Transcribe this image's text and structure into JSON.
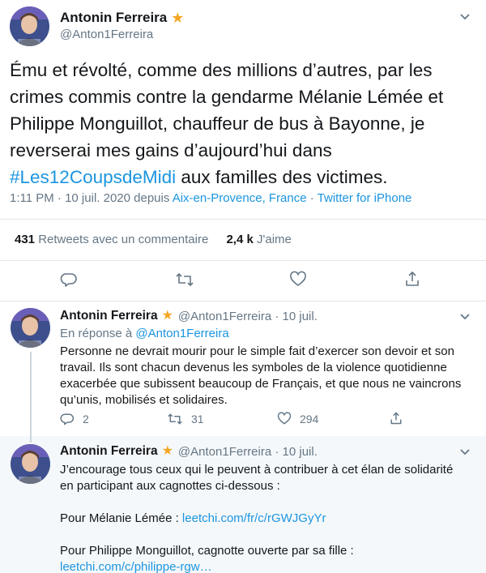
{
  "main_tweet": {
    "author_name": "Antonin Ferreira",
    "verified_star": "★",
    "handle": "@Anton1Ferreira",
    "text_line1": "Ému et révolté, comme des millions d’autres, par les",
    "text_line2": "crimes commis contre la gendarme Mélanie Lémée et",
    "text_line3": "Philippe Monguillot, chauffeur de bus à Bayonne, je",
    "text_line4": "reverserai mes gains d’aujourd’hui dans",
    "hashtag": "#Les12CoupsdeMidi",
    "text_line5_rest": " aux familles des victimes.",
    "time": "1:11 PM · 10 juil. 2020 depuis ",
    "location": "Aix-en-Provence, France",
    "separator": " · ",
    "source": "Twitter for iPhone",
    "retweets_count": "431",
    "retweets_label": " Retweets avec un commentaire",
    "likes_count": "2,4 k",
    "likes_label": " J'aime"
  },
  "reply_1": {
    "author_name": "Antonin Ferreira",
    "verified_star": "★",
    "handle_date": "@Anton1Ferreira · 10 juil.",
    "reply_prefix": "En réponse à ",
    "reply_handle": "@Anton1Ferreira",
    "line1": "Personne ne devrait mourir pour le simple fait d’exercer son devoir et son",
    "line2": "travail. Ils sont chacun devenus les symboles de la violence quotidienne",
    "line3": "exacerbée que subissent beaucoup de Français, et que nous ne vaincrons",
    "line4": "qu’unis, mobilisés et solidaires.",
    "reply_count": "2",
    "retweet_count": "31",
    "like_count": "294"
  },
  "reply_2": {
    "author_name": "Antonin Ferreira",
    "verified_star": "★",
    "handle_date": "@Anton1Ferreira · 10 juil.",
    "line1": "J’encourage tous ceux qui le peuvent à contribuer à cet élan de solidarité",
    "line2": "en participant aux cagnottes ci-dessous :",
    "line3_prefix": "Pour Mélanie Lémée : ",
    "line3_link": "leetchi.com/fr/c/rGWJGyYr",
    "line4": "Pour Philippe Monguillot, cagnotte ouverte par sa fille :",
    "line5_link": "leetchi.com/c/philippe-rgw…"
  },
  "icons": {
    "reply": "reply-icon",
    "retweet": "retweet-icon",
    "like": "heart-icon",
    "share": "share-icon",
    "more": "chevron-down-icon",
    "verified": "star-icon"
  },
  "colors": {
    "link": "#1b95e0",
    "secondary_text": "#657786",
    "star": "#f5a623",
    "divider": "#e1e8ed",
    "highlight_bg": "#f5f8fa"
  }
}
